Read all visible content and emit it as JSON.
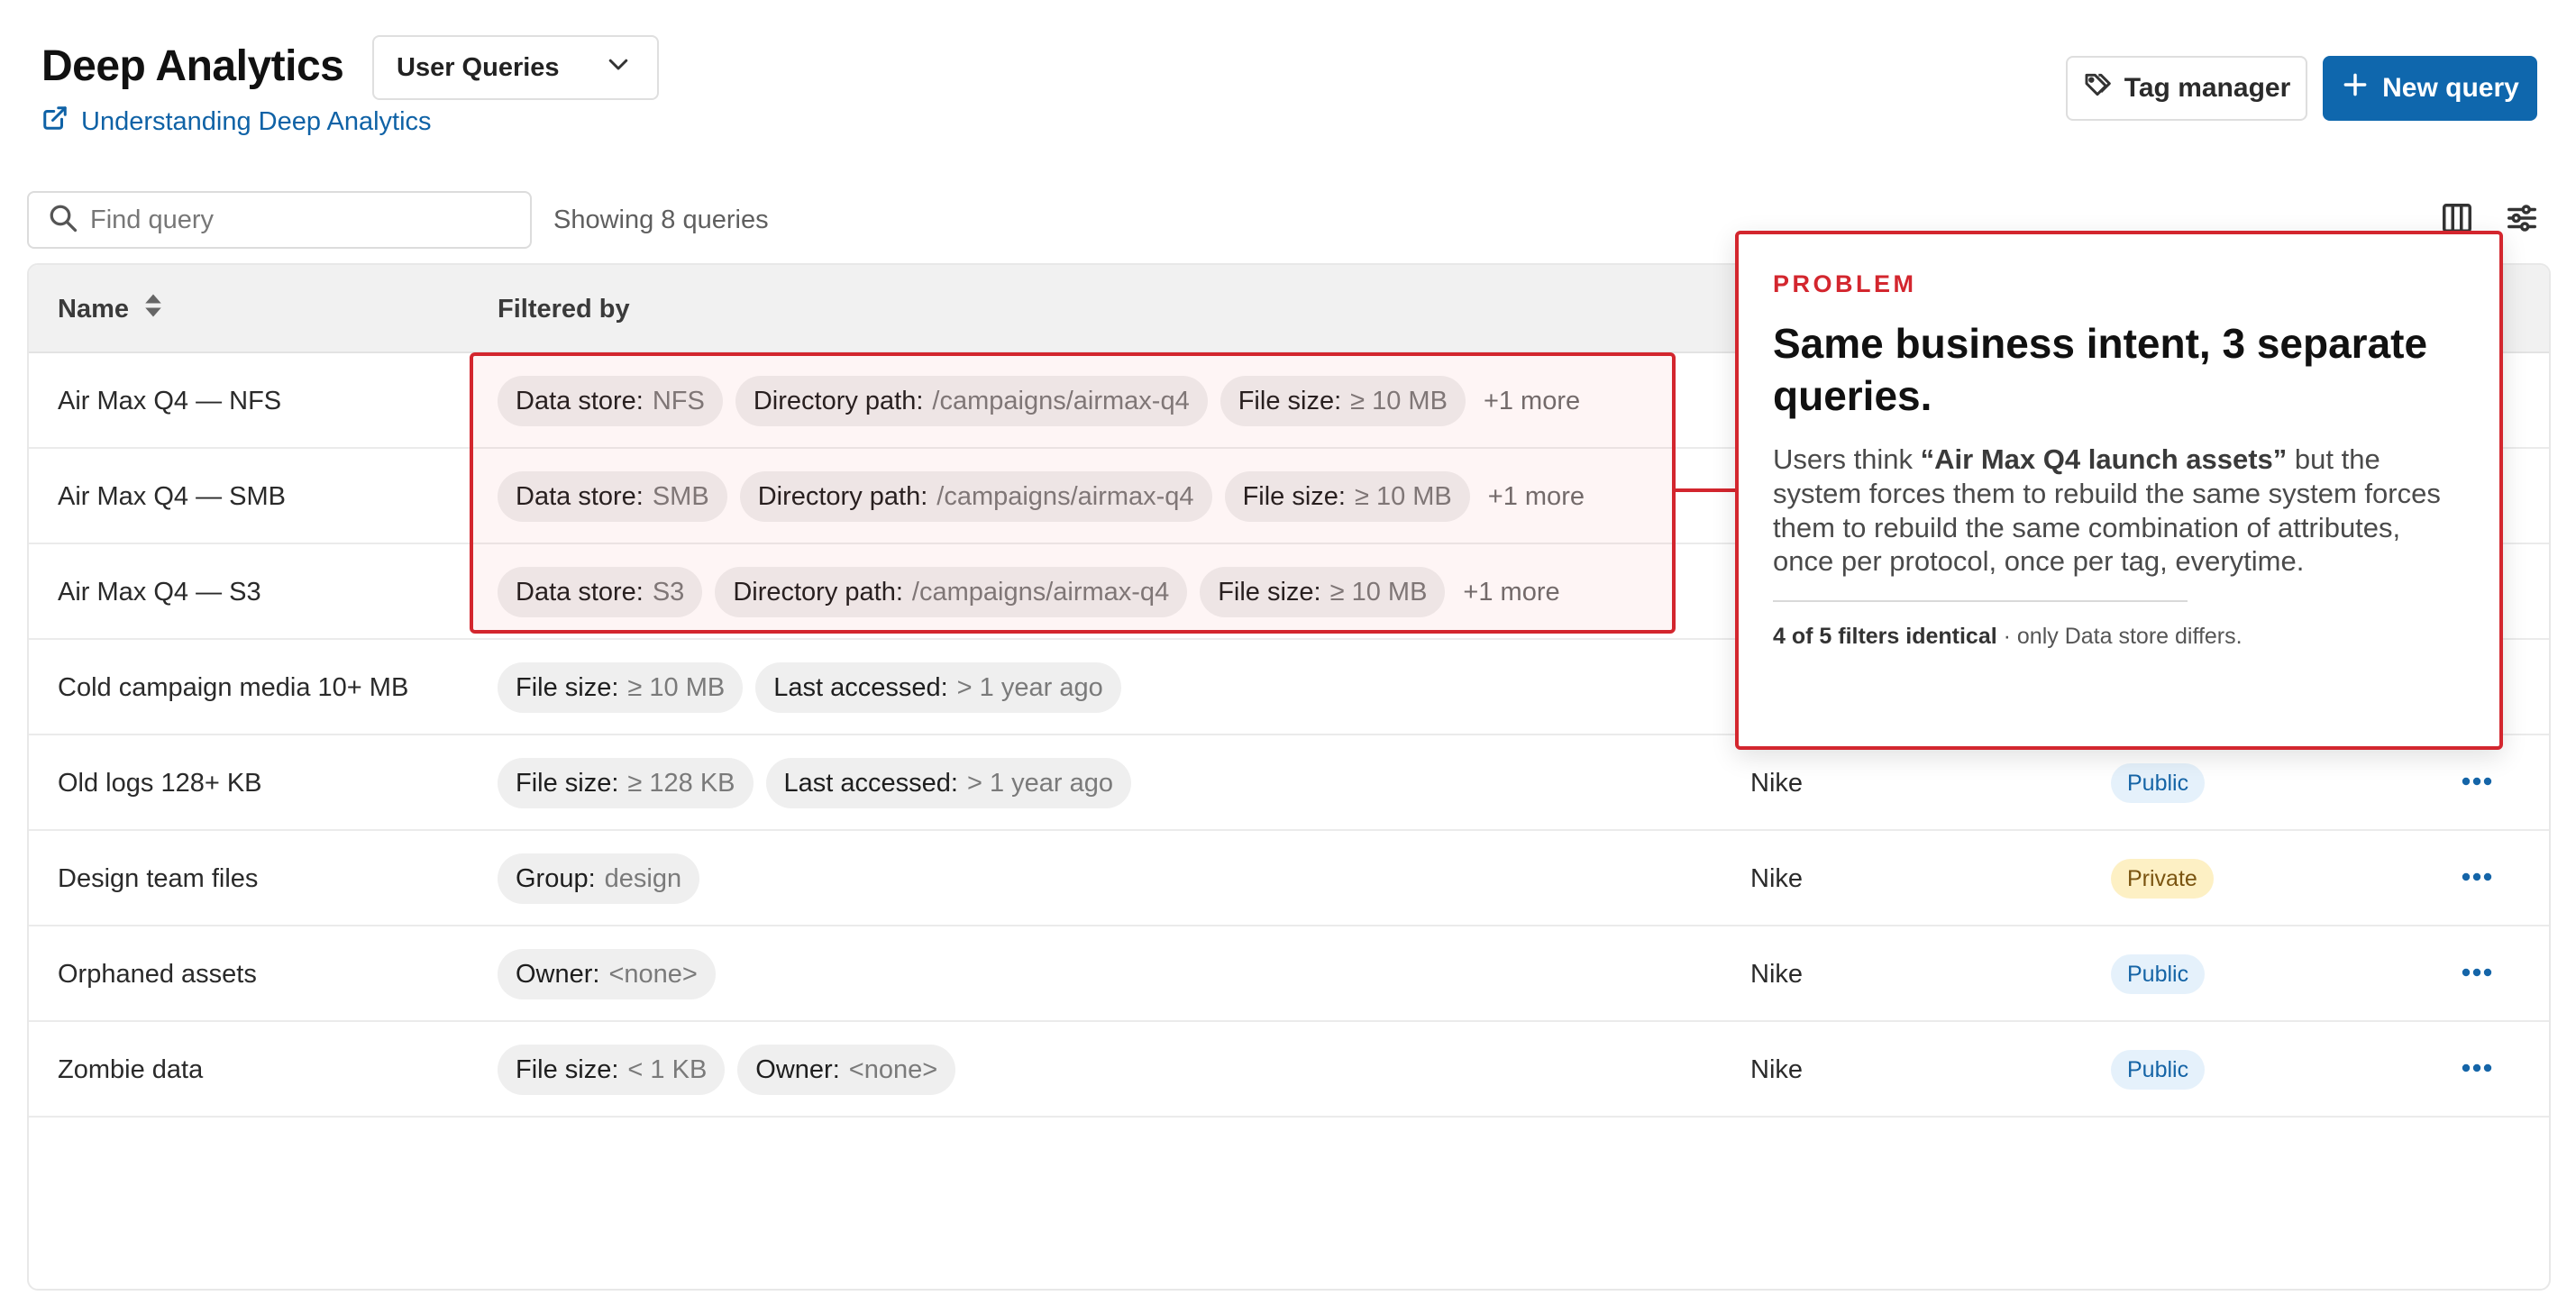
{
  "header": {
    "title": "Deep Analytics",
    "view_select": "User Queries",
    "doc_link": "Understanding Deep Analytics",
    "tag_manager_label": "Tag manager",
    "new_query_label": "New query"
  },
  "toolbar": {
    "search_placeholder": "Find query",
    "showing": "Showing 8 queries",
    "columns_icon": "columns-icon",
    "filters_icon": "sliders-icon"
  },
  "table": {
    "headers": {
      "name": "Name",
      "filtered_by": "Filtered by"
    },
    "rows": [
      {
        "name": "Air Max Q4 — NFS",
        "filters": [
          {
            "key": "Data store:",
            "value": "NFS"
          },
          {
            "key": "Directory path:",
            "value": "/campaigns/airmax-q4"
          },
          {
            "key": "File size:",
            "value": "≥ 10 MB"
          }
        ],
        "more": "+1 more"
      },
      {
        "name": "Air Max Q4 — SMB",
        "filters": [
          {
            "key": "Data store:",
            "value": "SMB"
          },
          {
            "key": "Directory path:",
            "value": "/campaigns/airmax-q4"
          },
          {
            "key": "File size:",
            "value": "≥ 10 MB"
          }
        ],
        "more": "+1 more"
      },
      {
        "name": "Air Max Q4 — S3",
        "filters": [
          {
            "key": "Data store:",
            "value": "S3"
          },
          {
            "key": "Directory path:",
            "value": "/campaigns/airmax-q4"
          },
          {
            "key": "File size:",
            "value": "≥ 10 MB"
          }
        ],
        "more": "+1 more"
      },
      {
        "name": "Cold campaign media 10+ MB",
        "filters": [
          {
            "key": "File size:",
            "value": "≥ 10 MB"
          },
          {
            "key": "Last accessed:",
            "value": "> 1 year ago"
          }
        ]
      },
      {
        "name": "Old logs 128+ KB",
        "filters": [
          {
            "key": "File size:",
            "value": "≥ 128 KB"
          },
          {
            "key": "Last accessed:",
            "value": "> 1 year ago"
          }
        ],
        "owner": "Nike",
        "visibility": "Public"
      },
      {
        "name": "Design team files",
        "filters": [
          {
            "key": "Group:",
            "value": "design"
          }
        ],
        "owner": "Nike",
        "visibility": "Private"
      },
      {
        "name": "Orphaned assets",
        "filters": [
          {
            "key": "Owner:",
            "value": "<none>"
          }
        ],
        "owner": "Nike",
        "visibility": "Public"
      },
      {
        "name": "Zombie data",
        "filters": [
          {
            "key": "File size:",
            "value": "< 1 KB"
          },
          {
            "key": "Owner:",
            "value": "<none>"
          }
        ],
        "owner": "Nike",
        "visibility": "Public"
      }
    ]
  },
  "callout": {
    "kicker": "PROBLEM",
    "title": "Same business intent, 3 separate queries.",
    "body_prefix": "Users think ",
    "body_emphasis": "“Air Max Q4 launch assets”",
    "body_suffix": " but the system forces them to rebuild the same system forces them to rebuild the same combination of attributes, once per protocol, once per tag, everytime.",
    "foot_bold": "4 of 5 filters identical",
    "foot_rest": " · only Data store differs."
  },
  "colors": {
    "accent_blue": "#0f67ad",
    "problem_red": "#d3262e",
    "public_badge": "#e5f1fb",
    "private_badge": "#fdf0c4"
  }
}
